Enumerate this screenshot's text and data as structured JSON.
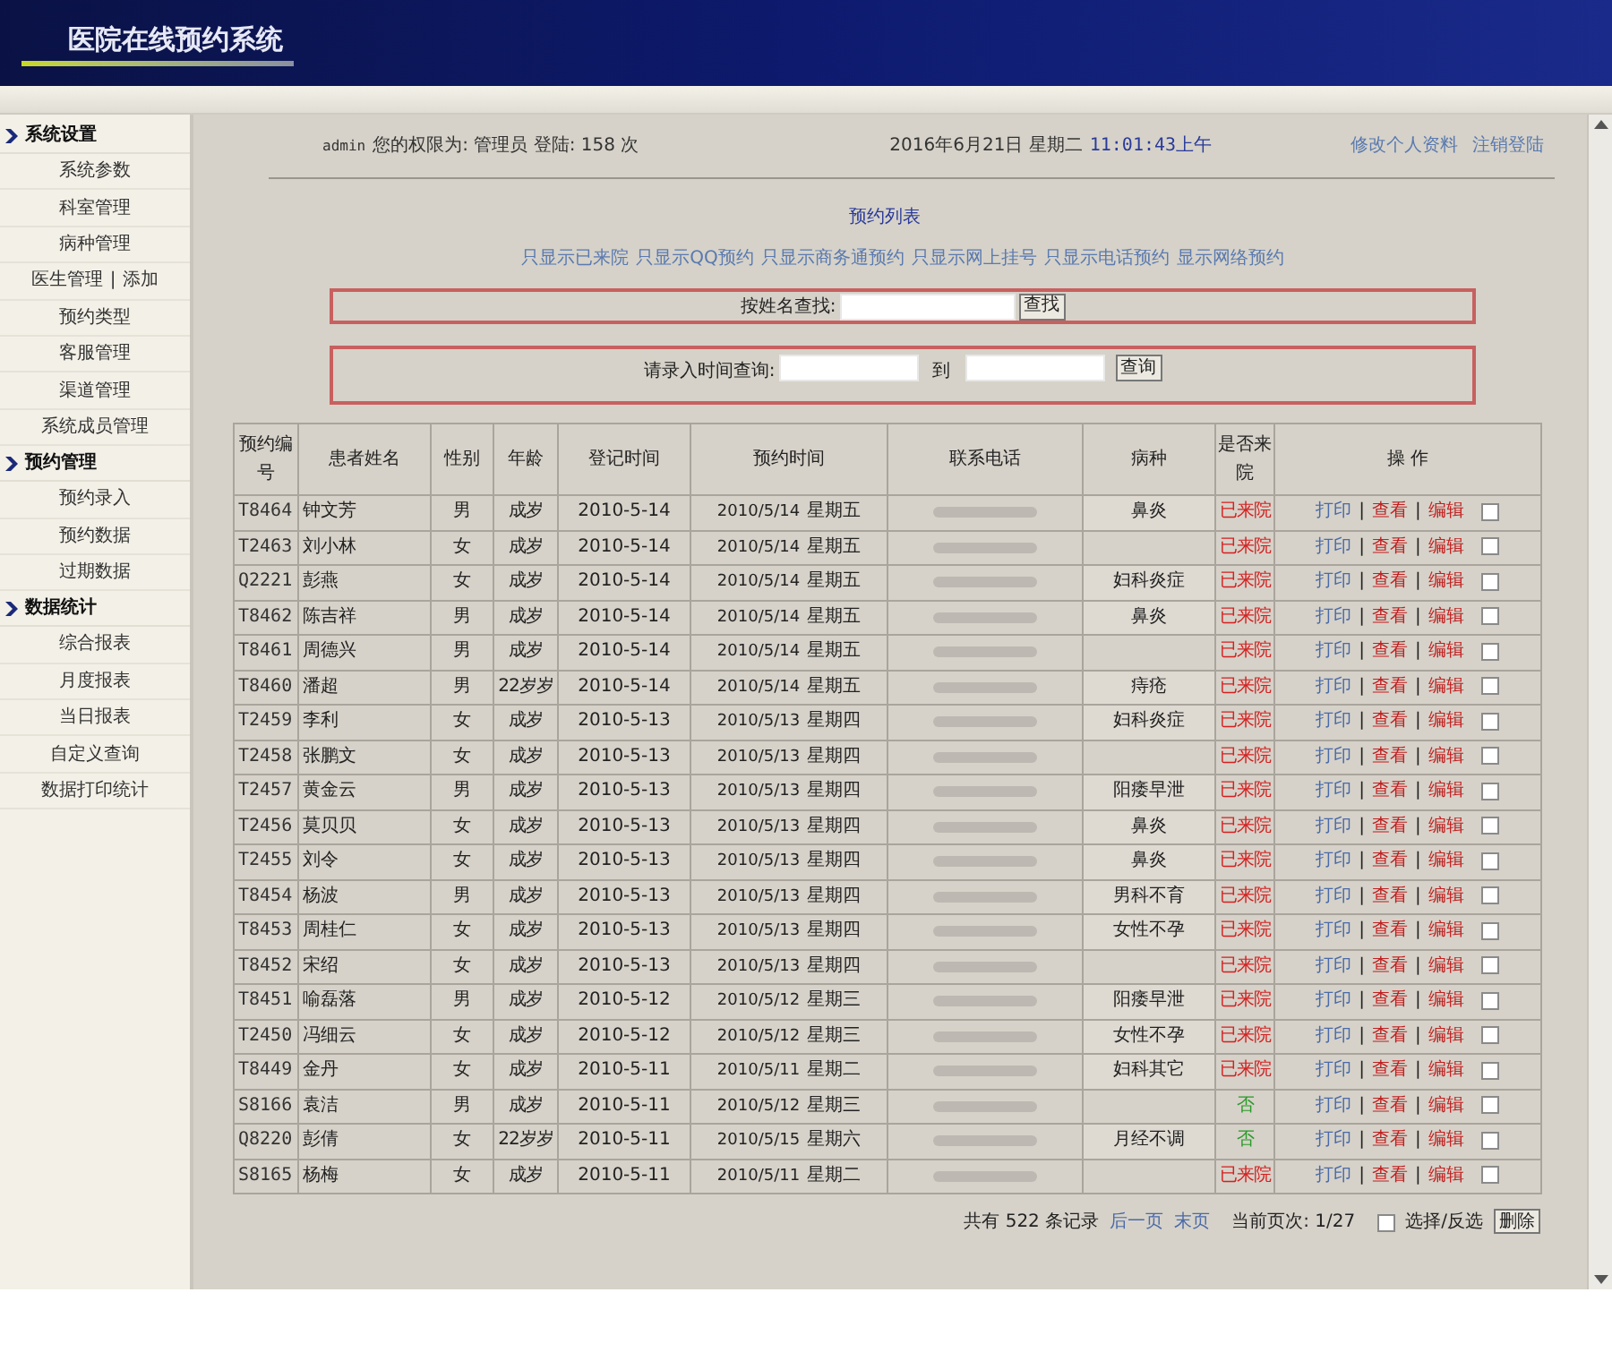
{
  "header": {
    "title": "医院在线预约系统"
  },
  "sidebar": {
    "sections": [
      {
        "title": "系统设置",
        "items": [
          {
            "label": "系统参数"
          },
          {
            "label": "科室管理"
          },
          {
            "label": "病种管理"
          },
          {
            "label": "医生管理",
            "separator": "|",
            "extra": "添加"
          },
          {
            "label": "预约类型"
          },
          {
            "label": "客服管理"
          },
          {
            "label": "渠道管理"
          },
          {
            "label": "系统成员管理"
          }
        ]
      },
      {
        "title": "预约管理",
        "items": [
          {
            "label": "预约录入"
          },
          {
            "label": "预约数据"
          },
          {
            "label": "过期数据"
          }
        ]
      },
      {
        "title": "数据统计",
        "items": [
          {
            "label": "综合报表"
          },
          {
            "label": "月度报表"
          },
          {
            "label": "当日报表"
          },
          {
            "label": "自定义查询"
          },
          {
            "label": "数据打印统计"
          }
        ]
      }
    ]
  },
  "info_bar": {
    "user": "admin",
    "role_text": "您的权限为: 管理员 登陆: 158 次",
    "date": "2016年6月21日 星期二",
    "time": "11:01:43上午",
    "links": [
      "修改个人资料",
      "注销登陆"
    ]
  },
  "list_title": "预约列表",
  "filters": [
    "只显示已来院",
    "只显示QQ预约",
    "只显示商务通预约",
    "只显示网上挂号",
    "只显示电话预约",
    "显示网络预约"
  ],
  "name_search": {
    "label": "按姓名查找:",
    "button": "查找"
  },
  "date_search": {
    "label": "请录入时间查询:",
    "to": "到",
    "button": "查询"
  },
  "table": {
    "columns": [
      "预约编号",
      "患者姓名",
      "性别",
      "年龄",
      "登记时间",
      "预约时间",
      "联系电话",
      "病种",
      "是否来院",
      "操 作"
    ],
    "rows": [
      {
        "id": "T8464",
        "name": "钟文芳",
        "sex": "男",
        "age": "成岁",
        "reg": "2010-5-14",
        "date": "2010/5/14",
        "weekday": "星期五",
        "disease": "鼻炎",
        "visit": "已来院",
        "arrived": true,
        "actions": [
          "打印",
          "|",
          "查看",
          "|",
          "编辑"
        ],
        "checked": false
      },
      {
        "id": "T2463",
        "name": "刘小林",
        "sex": "女",
        "age": "成岁",
        "reg": "2010-5-14",
        "date": "2010/5/14",
        "weekday": "星期五",
        "disease": "",
        "visit": "已来院",
        "arrived": true,
        "actions": [
          "打印",
          "|",
          "查看",
          "|",
          "编辑"
        ],
        "checked": false
      },
      {
        "id": "Q2221",
        "name": "彭燕",
        "sex": "女",
        "age": "成岁",
        "reg": "2010-5-14",
        "date": "2010/5/14",
        "weekday": "星期五",
        "disease": "妇科炎症",
        "visit": "已来院",
        "arrived": true,
        "actions": [
          "打印",
          "|",
          "查看",
          "|",
          "编辑"
        ],
        "checked": false
      },
      {
        "id": "T8462",
        "name": "陈吉祥",
        "sex": "男",
        "age": "成岁",
        "reg": "2010-5-14",
        "date": "2010/5/14",
        "weekday": "星期五",
        "disease": "鼻炎",
        "visit": "已来院",
        "arrived": true,
        "actions": [
          "打印",
          "|",
          "查看",
          "|",
          "编辑"
        ],
        "checked": false
      },
      {
        "id": "T8461",
        "name": "周德兴",
        "sex": "男",
        "age": "成岁",
        "reg": "2010-5-14",
        "date": "2010/5/14",
        "weekday": "星期五",
        "disease": "",
        "visit": "已来院",
        "arrived": true,
        "actions": [
          "打印",
          "|",
          "查看",
          "|",
          "编辑"
        ],
        "checked": false
      },
      {
        "id": "T8460",
        "name": "潘超",
        "sex": "男",
        "age": "22岁岁",
        "reg": "2010-5-14",
        "date": "2010/5/14",
        "weekday": "星期五",
        "disease": "痔疮",
        "visit": "已来院",
        "arrived": true,
        "actions": [
          "打印",
          "|",
          "查看",
          "|",
          "编辑"
        ],
        "checked": false
      },
      {
        "id": "T2459",
        "name": "李利",
        "sex": "女",
        "age": "成岁",
        "reg": "2010-5-13",
        "date": "2010/5/13",
        "weekday": "星期四",
        "disease": "妇科炎症",
        "visit": "已来院",
        "arrived": true,
        "actions": [
          "打印",
          "|",
          "查看",
          "|",
          "编辑"
        ],
        "checked": false
      },
      {
        "id": "T2458",
        "name": "张鹏文",
        "sex": "女",
        "age": "成岁",
        "reg": "2010-5-13",
        "date": "2010/5/13",
        "weekday": "星期四",
        "disease": "",
        "visit": "已来院",
        "arrived": true,
        "actions": [
          "打印",
          "|",
          "查看",
          "|",
          "编辑"
        ],
        "checked": false
      },
      {
        "id": "T2457",
        "name": "黄金云",
        "sex": "男",
        "age": "成岁",
        "reg": "2010-5-13",
        "date": "2010/5/13",
        "weekday": "星期四",
        "disease": "阳痿早泄",
        "visit": "已来院",
        "arrived": true,
        "actions": [
          "打印",
          "|",
          "查看",
          "|",
          "编辑"
        ],
        "checked": false
      },
      {
        "id": "T2456",
        "name": "莫贝贝",
        "sex": "女",
        "age": "成岁",
        "reg": "2010-5-13",
        "date": "2010/5/13",
        "weekday": "星期四",
        "disease": "鼻炎",
        "visit": "已来院",
        "arrived": true,
        "actions": [
          "打印",
          "|",
          "查看",
          "|",
          "编辑"
        ],
        "checked": false
      },
      {
        "id": "T2455",
        "name": "刘令",
        "sex": "女",
        "age": "成岁",
        "reg": "2010-5-13",
        "date": "2010/5/13",
        "weekday": "星期四",
        "disease": "鼻炎",
        "visit": "已来院",
        "arrived": true,
        "actions": [
          "打印",
          "|",
          "查看",
          "|",
          "编辑"
        ],
        "checked": false
      },
      {
        "id": "T8454",
        "name": "杨波",
        "sex": "男",
        "age": "成岁",
        "reg": "2010-5-13",
        "date": "2010/5/13",
        "weekday": "星期四",
        "disease": "男科不育",
        "visit": "已来院",
        "arrived": true,
        "actions": [
          "打印",
          "|",
          "查看",
          "|",
          "编辑"
        ],
        "checked": false
      },
      {
        "id": "T8453",
        "name": "周桂仁",
        "sex": "女",
        "age": "成岁",
        "reg": "2010-5-13",
        "date": "2010/5/13",
        "weekday": "星期四",
        "disease": "女性不孕",
        "visit": "已来院",
        "arrived": true,
        "actions": [
          "打印",
          "|",
          "查看",
          "|",
          "编辑"
        ],
        "checked": false
      },
      {
        "id": "T8452",
        "name": "宋绍",
        "sex": "女",
        "age": "成岁",
        "reg": "2010-5-13",
        "date": "2010/5/13",
        "weekday": "星期四",
        "disease": "",
        "visit": "已来院",
        "arrived": true,
        "actions": [
          "打印",
          "|",
          "查看",
          "|",
          "编辑"
        ],
        "checked": false
      },
      {
        "id": "T8451",
        "name": "喻磊落",
        "sex": "男",
        "age": "成岁",
        "reg": "2010-5-12",
        "date": "2010/5/12",
        "weekday": "星期三",
        "disease": "阳痿早泄",
        "visit": "已来院",
        "arrived": true,
        "actions": [
          "打印",
          "|",
          "查看",
          "|",
          "编辑"
        ],
        "checked": false
      },
      {
        "id": "T2450",
        "name": "冯细云",
        "sex": "女",
        "age": "成岁",
        "reg": "2010-5-12",
        "date": "2010/5/12",
        "weekday": "星期三",
        "disease": "女性不孕",
        "visit": "已来院",
        "arrived": true,
        "actions": [
          "打印",
          "|",
          "查看",
          "|",
          "编辑"
        ],
        "checked": false
      },
      {
        "id": "T8449",
        "name": "金丹",
        "sex": "女",
        "age": "成岁",
        "reg": "2010-5-11",
        "date": "2010/5/11",
        "weekday": "星期二",
        "disease": "妇科其它",
        "visit": "已来院",
        "arrived": true,
        "actions": [
          "打印",
          "|",
          "查看",
          "|",
          "编辑"
        ],
        "checked": false
      },
      {
        "id": "S8166",
        "name": "袁洁",
        "sex": "男",
        "age": "成岁",
        "reg": "2010-5-11",
        "date": "2010/5/12",
        "weekday": "星期三",
        "disease": "",
        "visit": "否",
        "arrived": false,
        "actions": [
          "打印",
          "|",
          "查看",
          "|",
          "编辑"
        ],
        "checked": false
      },
      {
        "id": "Q8220",
        "name": "彭倩",
        "sex": "女",
        "age": "22岁岁",
        "reg": "2010-5-11",
        "date": "2010/5/15",
        "weekday": "星期六",
        "disease": "月经不调",
        "visit": "否",
        "arrived": false,
        "actions": [
          "打印",
          "|",
          "查看",
          "|",
          "编辑"
        ],
        "checked": false
      },
      {
        "id": "S8165",
        "name": "杨梅",
        "sex": "女",
        "age": "成岁",
        "reg": "2010-5-11",
        "date": "2010/5/11",
        "weekday": "星期二",
        "disease": "",
        "visit": "已来院",
        "arrived": true,
        "actions": [
          "打印",
          "|",
          "查看",
          "|",
          "编辑"
        ],
        "checked": false
      }
    ]
  },
  "footer": {
    "total": "共有 522 条记录",
    "links": [
      "后一页",
      "末页"
    ],
    "page": "当前页次: 1/27",
    "select_all_checked": false,
    "select_all": "选择/反选",
    "delete_button": "删除"
  }
}
